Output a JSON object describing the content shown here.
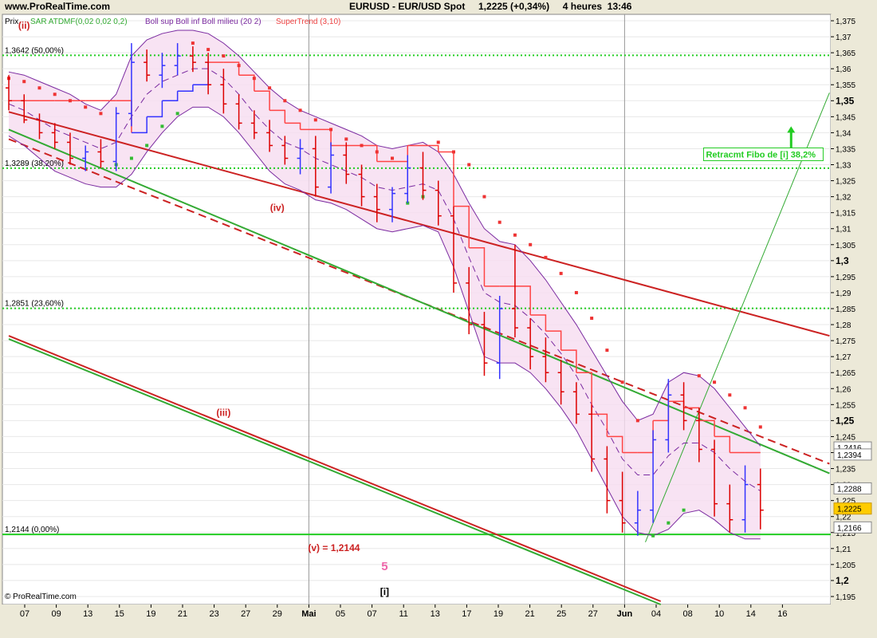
{
  "header": {
    "site": "www.ProRealTime.com",
    "title": "EURUSD - EUR/USD Spot     1,2225 (+0,34%)     4 heures  13:46"
  },
  "legend": {
    "prix": "Prix",
    "sar": "SAR ATDMF(0,02 0,02 0,2)",
    "boll": "Boll sup Boll inf Boll milieu (20 2)",
    "supertrend": "SuperTrend (3,10)"
  },
  "copyright": "© ProRealTime.com",
  "colors": {
    "background": "#ffffff",
    "panel": "#ece9d8",
    "price_up": "#3333ff",
    "price_down": "#dd0000",
    "sar_up": "#33bb33",
    "sar_down": "#ee3333",
    "bollinger": "#7a2aa0",
    "bollinger_fill": "#f6dcf0",
    "supertrend": "#ff4444",
    "fibo": "#22cc22",
    "channel_red": "#cc2222",
    "channel_green": "#33aa33",
    "wave_label": "#cc2222",
    "wave5_label": "#ee66aa"
  },
  "chart_data": {
    "type": "candlestick",
    "instrument": "EURUSD - EUR/USD Spot",
    "timeframe": "4 heures",
    "last_price": 1.2225,
    "change_pct": "+0,34%",
    "ylim": [
      1.1925,
      1.377
    ],
    "y_ticks": [
      "1,375",
      "1,37",
      "1,365",
      "1,36",
      "1,355",
      "1,35",
      "1,345",
      "1,34",
      "1,335",
      "1,33",
      "1,325",
      "1,32",
      "1,315",
      "1,31",
      "1,305",
      "1,3",
      "1,295",
      "1,29",
      "1,285",
      "1,28",
      "1,275",
      "1,27",
      "1,265",
      "1,26",
      "1,255",
      "1,25",
      "1,245",
      "1,24",
      "1,235",
      "1,23",
      "1,225",
      "1,22",
      "1,215",
      "1,21",
      "1,205",
      "1,2",
      "1,195"
    ],
    "y_ticks_bold": [
      "1,35",
      "1,3",
      "1,25",
      "1,2"
    ],
    "x_ticks": [
      "07",
      "09",
      "13",
      "15",
      "19",
      "21",
      "23",
      "27",
      "29",
      "Mai",
      "05",
      "07",
      "11",
      "13",
      "17",
      "19",
      "21",
      "25",
      "27",
      "Jun",
      "04",
      "08",
      "10",
      "14",
      "16"
    ],
    "fibonacci_levels": [
      {
        "label": "1,3642 (50,00%)",
        "value": 1.3642
      },
      {
        "label": "1,3289 (38,20%)",
        "value": 1.3289
      },
      {
        "label": "1,2851 (23,60%)",
        "value": 1.2851
      },
      {
        "label": "1,2144 (0,00%)",
        "value": 1.2144
      }
    ],
    "price_tags": [
      {
        "label": "1,2416",
        "value": 1.2416
      },
      {
        "label": "1,2394",
        "value": 1.2394
      },
      {
        "label": "1,2288",
        "value": 1.2288
      },
      {
        "label": "1,2225",
        "value": 1.2225,
        "highlight": true
      },
      {
        "label": "1,2166",
        "value": 1.2166
      }
    ],
    "wave_labels": [
      {
        "text": "(ii)",
        "x": 1.0,
        "y": 1.3725
      },
      {
        "text": "(iv)",
        "x": 17.5,
        "y": 1.3155
      },
      {
        "text": "(iii)",
        "x": 14.0,
        "y": 1.2515
      },
      {
        "text": "(v) = 1,2144",
        "x": 21.2,
        "y": 1.2092
      },
      {
        "text": "5",
        "x": 24.5,
        "y": 1.2032
      },
      {
        "text": "[i]",
        "x": 24.5,
        "y": 1.1955
      }
    ],
    "annotation": {
      "text": "Retracmt Fibo de [i] 38,2%",
      "x": 45.5,
      "y": 1.3325
    },
    "channel_lines": [
      {
        "color": "red",
        "style": "solid",
        "x1": 0,
        "y1": 1.3465,
        "x2": 53.5,
        "y2": 1.2765
      },
      {
        "color": "red",
        "style": "solid",
        "x1": 0,
        "y1": 1.2765,
        "x2": 42.5,
        "y2": 1.1935
      },
      {
        "color": "red",
        "style": "dashed",
        "x1": 0,
        "y1": 1.338,
        "x2": 53.5,
        "y2": 1.2365
      },
      {
        "color": "green",
        "style": "solid",
        "x1": 0,
        "y1": 1.341,
        "x2": 53.5,
        "y2": 1.2335
      },
      {
        "color": "green",
        "style": "solid",
        "x1": 0,
        "y1": 1.2755,
        "x2": 42.5,
        "y2": 1.1925
      },
      {
        "color": "green",
        "style": "solid",
        "x1": 41.5,
        "y1": 1.212,
        "x2": 53.5,
        "y2": 1.3525
      }
    ],
    "target_arrow": {
      "x": 51.0,
      "y_from": 1.3335,
      "y_to": 1.3405
    },
    "candles": [
      [
        1.354,
        1.358,
        1.347,
        1.35
      ],
      [
        1.35,
        1.352,
        1.343,
        1.344
      ],
      [
        1.344,
        1.346,
        1.338,
        1.34
      ],
      [
        1.34,
        1.343,
        1.335,
        1.337
      ],
      [
        1.337,
        1.34,
        1.33,
        1.332
      ],
      [
        1.332,
        1.336,
        1.328,
        1.334
      ],
      [
        1.334,
        1.338,
        1.329,
        1.331
      ],
      [
        1.331,
        1.348,
        1.328,
        1.346
      ],
      [
        1.346,
        1.368,
        1.342,
        1.362
      ],
      [
        1.362,
        1.366,
        1.356,
        1.358
      ],
      [
        1.358,
        1.365,
        1.354,
        1.361
      ],
      [
        1.361,
        1.368,
        1.358,
        1.364
      ],
      [
        1.364,
        1.367,
        1.359,
        1.362
      ],
      [
        1.362,
        1.365,
        1.352,
        1.355
      ],
      [
        1.355,
        1.36,
        1.346,
        1.349
      ],
      [
        1.349,
        1.352,
        1.341,
        1.343
      ],
      [
        1.343,
        1.347,
        1.338,
        1.34
      ],
      [
        1.34,
        1.344,
        1.334,
        1.336
      ],
      [
        1.336,
        1.339,
        1.33,
        1.332
      ],
      [
        1.332,
        1.338,
        1.327,
        1.335
      ],
      [
        1.335,
        1.339,
        1.32,
        1.323
      ],
      [
        1.323,
        1.337,
        1.321,
        1.333
      ],
      [
        1.333,
        1.337,
        1.324,
        1.327
      ],
      [
        1.327,
        1.33,
        1.317,
        1.32
      ],
      [
        1.32,
        1.324,
        1.312,
        1.316
      ],
      [
        1.316,
        1.323,
        1.312,
        1.321
      ],
      [
        1.321,
        1.333,
        1.318,
        1.329
      ],
      [
        1.329,
        1.334,
        1.319,
        1.322
      ],
      [
        1.322,
        1.325,
        1.311,
        1.314
      ],
      [
        1.314,
        1.317,
        1.29,
        1.293
      ],
      [
        1.293,
        1.298,
        1.277,
        1.28
      ],
      [
        1.28,
        1.284,
        1.264,
        1.268
      ],
      [
        1.268,
        1.289,
        1.263,
        1.285
      ],
      [
        1.285,
        1.305,
        1.276,
        1.279
      ],
      [
        1.279,
        1.282,
        1.266,
        1.27
      ],
      [
        1.27,
        1.276,
        1.262,
        1.265
      ],
      [
        1.265,
        1.269,
        1.255,
        1.259
      ],
      [
        1.259,
        1.262,
        1.249,
        1.252
      ],
      [
        1.252,
        1.255,
        1.234,
        1.238
      ],
      [
        1.238,
        1.242,
        1.221,
        1.225
      ],
      [
        1.225,
        1.234,
        1.215,
        1.218
      ],
      [
        1.218,
        1.228,
        1.214,
        1.222
      ],
      [
        1.222,
        1.247,
        1.218,
        1.244
      ],
      [
        1.244,
        1.263,
        1.24,
        1.258
      ],
      [
        1.258,
        1.262,
        1.247,
        1.25
      ],
      [
        1.25,
        1.254,
        1.237,
        1.241
      ],
      [
        1.241,
        1.244,
        1.22,
        1.224
      ],
      [
        1.224,
        1.23,
        1.215,
        1.219
      ],
      [
        1.219,
        1.236,
        1.215,
        1.23
      ],
      [
        1.23,
        1.235,
        1.216,
        1.222
      ]
    ],
    "bollinger_upper": [
      1.359,
      1.358,
      1.356,
      1.354,
      1.352,
      1.349,
      1.347,
      1.352,
      1.364,
      1.369,
      1.371,
      1.372,
      1.372,
      1.371,
      1.368,
      1.364,
      1.359,
      1.354,
      1.35,
      1.347,
      1.345,
      1.343,
      1.341,
      1.339,
      1.336,
      1.335,
      1.336,
      1.337,
      1.334,
      1.327,
      1.318,
      1.31,
      1.306,
      1.305,
      1.3,
      1.294,
      1.287,
      1.28,
      1.272,
      1.264,
      1.256,
      1.25,
      1.252,
      1.262,
      1.265,
      1.264,
      1.26,
      1.254,
      1.248,
      1.242
    ],
    "bollinger_lower": [
      1.339,
      1.336,
      1.332,
      1.328,
      1.326,
      1.324,
      1.323,
      1.323,
      1.327,
      1.334,
      1.34,
      1.345,
      1.348,
      1.348,
      1.345,
      1.34,
      1.334,
      1.328,
      1.324,
      1.322,
      1.319,
      1.318,
      1.316,
      1.313,
      1.31,
      1.309,
      1.31,
      1.311,
      1.309,
      1.298,
      1.284,
      1.27,
      1.268,
      1.268,
      1.265,
      1.26,
      1.254,
      1.247,
      1.238,
      1.229,
      1.22,
      1.215,
      1.214,
      1.216,
      1.221,
      1.222,
      1.219,
      1.215,
      1.213,
      1.213
    ],
    "bollinger_middle": [
      1.349,
      1.347,
      1.344,
      1.341,
      1.339,
      1.337,
      1.335,
      1.337,
      1.345,
      1.352,
      1.356,
      1.358,
      1.36,
      1.36,
      1.357,
      1.352,
      1.346,
      1.341,
      1.337,
      1.335,
      1.332,
      1.33,
      1.328,
      1.326,
      1.323,
      1.322,
      1.323,
      1.324,
      1.322,
      1.313,
      1.301,
      1.29,
      1.287,
      1.286,
      1.282,
      1.277,
      1.271,
      1.264,
      1.255,
      1.247,
      1.238,
      1.233,
      1.233,
      1.239,
      1.243,
      1.243,
      1.24,
      1.235,
      1.231,
      1.228
    ],
    "supertrend": [
      1.35,
      1.35,
      1.35,
      1.35,
      1.35,
      1.35,
      1.35,
      1.35,
      1.34,
      1.345,
      1.35,
      1.353,
      1.355,
      1.362,
      1.362,
      1.358,
      1.353,
      1.347,
      1.343,
      1.341,
      1.341,
      1.336,
      1.336,
      1.336,
      1.331,
      1.331,
      1.336,
      1.336,
      1.334,
      1.317,
      1.304,
      1.292,
      1.292,
      1.292,
      1.283,
      1.278,
      1.272,
      1.265,
      1.252,
      1.245,
      1.24,
      1.24,
      1.25,
      1.256,
      1.254,
      1.25,
      1.245,
      1.24,
      1.24,
      1.24
    ],
    "supertrend_trend": [
      "down",
      "down",
      "down",
      "down",
      "down",
      "down",
      "down",
      "down",
      "up",
      "up",
      "up",
      "up",
      "up",
      "down",
      "down",
      "down",
      "down",
      "down",
      "down",
      "down",
      "down",
      "down",
      "down",
      "down",
      "down",
      "down",
      "down",
      "down",
      "down",
      "down",
      "down",
      "down",
      "down",
      "down",
      "down",
      "down",
      "down",
      "down",
      "down",
      "down",
      "down",
      "down",
      "down",
      "down",
      "down",
      "down",
      "down",
      "down",
      "down",
      "down"
    ],
    "sar": [
      1.357,
      1.356,
      1.354,
      1.352,
      1.35,
      1.348,
      1.346,
      1.33,
      1.332,
      1.336,
      1.342,
      1.346,
      1.368,
      1.366,
      1.364,
      1.361,
      1.357,
      1.354,
      1.35,
      1.347,
      1.344,
      1.341,
      1.338,
      1.336,
      1.334,
      1.332,
      1.318,
      1.32,
      1.337,
      1.334,
      1.33,
      1.32,
      1.312,
      1.308,
      1.305,
      1.301,
      1.296,
      1.29,
      1.282,
      1.272,
      1.262,
      1.25,
      1.214,
      1.218,
      1.222,
      1.264,
      1.262,
      1.258,
      1.254,
      1.248
    ],
    "sar_trend": [
      "down",
      "down",
      "down",
      "down",
      "down",
      "down",
      "down",
      "up",
      "up",
      "up",
      "up",
      "up",
      "down",
      "down",
      "down",
      "down",
      "down",
      "down",
      "down",
      "down",
      "down",
      "down",
      "down",
      "down",
      "down",
      "down",
      "up",
      "up",
      "down",
      "down",
      "down",
      "down",
      "down",
      "down",
      "down",
      "down",
      "down",
      "down",
      "down",
      "down",
      "down",
      "down",
      "up",
      "up",
      "up",
      "down",
      "down",
      "down",
      "down",
      "down"
    ]
  }
}
